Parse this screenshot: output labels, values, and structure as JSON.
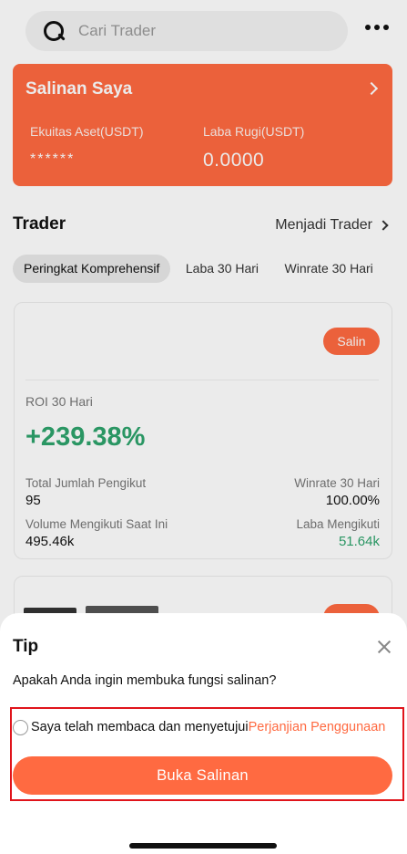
{
  "search": {
    "placeholder": "Cari Trader"
  },
  "copy_card": {
    "title": "Salinan Saya",
    "equity_label": "Ekuitas Aset(USDT)",
    "equity_value": "******",
    "pnl_label": "Laba Rugi(USDT)",
    "pnl_value": "0.0000"
  },
  "trader_section": {
    "title": "Trader",
    "become_trader": "Menjadi Trader"
  },
  "tabs": [
    {
      "label": "Peringkat Komprehensif",
      "active": true
    },
    {
      "label": "Laba 30 Hari",
      "active": false
    },
    {
      "label": "Winrate 30 Hari",
      "active": false
    }
  ],
  "trader_card": {
    "copy_button": "Salin",
    "roi_label": "ROI 30 Hari",
    "roi_value": "+239.38%",
    "followers_label": "Total Jumlah Pengikut",
    "followers_value": "95",
    "winrate_label": "Winrate 30 Hari",
    "winrate_value": "100.00%",
    "volume_label": "Volume Mengikuti Saat Ini",
    "volume_value": "495.46k",
    "profit_label": "Laba Mengikuti",
    "profit_value": "51.64k"
  },
  "dialog": {
    "title": "Tip",
    "question": "Apakah Anda ingin membuka fungsi salinan?",
    "agree_text": "Saya telah membaca dan menyetujui",
    "agree_link": "Perjanjian Penggunaan",
    "open_button": "Buka Salinan"
  },
  "colors": {
    "accent": "#ff6a41",
    "positive": "#2ea36c",
    "highlight": "#e0141b"
  }
}
